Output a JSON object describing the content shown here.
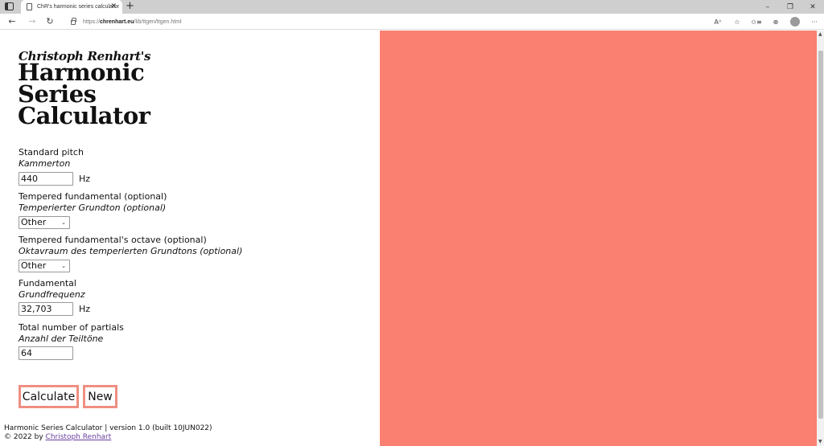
{
  "browser": {
    "tab_title": "ChR's harmonic series calculator",
    "tab_close": "✕",
    "new_tab": "+",
    "url_prefix": "https://",
    "url_domain": "chrenhart.eu",
    "url_path": "/lib/ttgen/ttgen.html",
    "window_controls": {
      "minimize": "–",
      "restore": "❐",
      "close": "✕"
    },
    "nav": {
      "back": "←",
      "forward": "→",
      "reload": "↻"
    },
    "toolbar_icons": {
      "read_aloud": "Aᴬ",
      "add_favorite": "☆",
      "favorites": "✩≡",
      "collections": "⊕",
      "more": "···"
    }
  },
  "page": {
    "byline": "Christoph Renhart's",
    "title_lines": [
      "Harmonic",
      "Series",
      "Calculator"
    ],
    "fields": {
      "standard_pitch": {
        "label": "Standard pitch",
        "label_de": "Kammerton",
        "value": "440",
        "unit": "Hz"
      },
      "tempered_fundamental": {
        "label": "Tempered fundamental (optional)",
        "label_de": "Temperierter Grundton (optional)",
        "selected": "Other"
      },
      "tempered_octave": {
        "label": "Tempered fundamental's octave (optional)",
        "label_de": "Oktavraum des temperierten Grundtons (optional)",
        "selected": "Other"
      },
      "fundamental": {
        "label": "Fundamental",
        "label_de": "Grundfrequenz",
        "value": "32,703",
        "unit": "Hz"
      },
      "partials": {
        "label": "Total number of partials",
        "label_de": "Anzahl der Teiltöne",
        "value": "64"
      }
    },
    "buttons": {
      "calculate": "Calculate",
      "new": "New"
    },
    "footer": {
      "line1": "Harmonic Series Calculator | version 1.0 (built 10JUN022)",
      "line2_prefix": "© 2022 by ",
      "author_link": "Christoph Renhart"
    },
    "colors": {
      "accent": "#fa8072",
      "button_border": "#ef8f82"
    }
  }
}
